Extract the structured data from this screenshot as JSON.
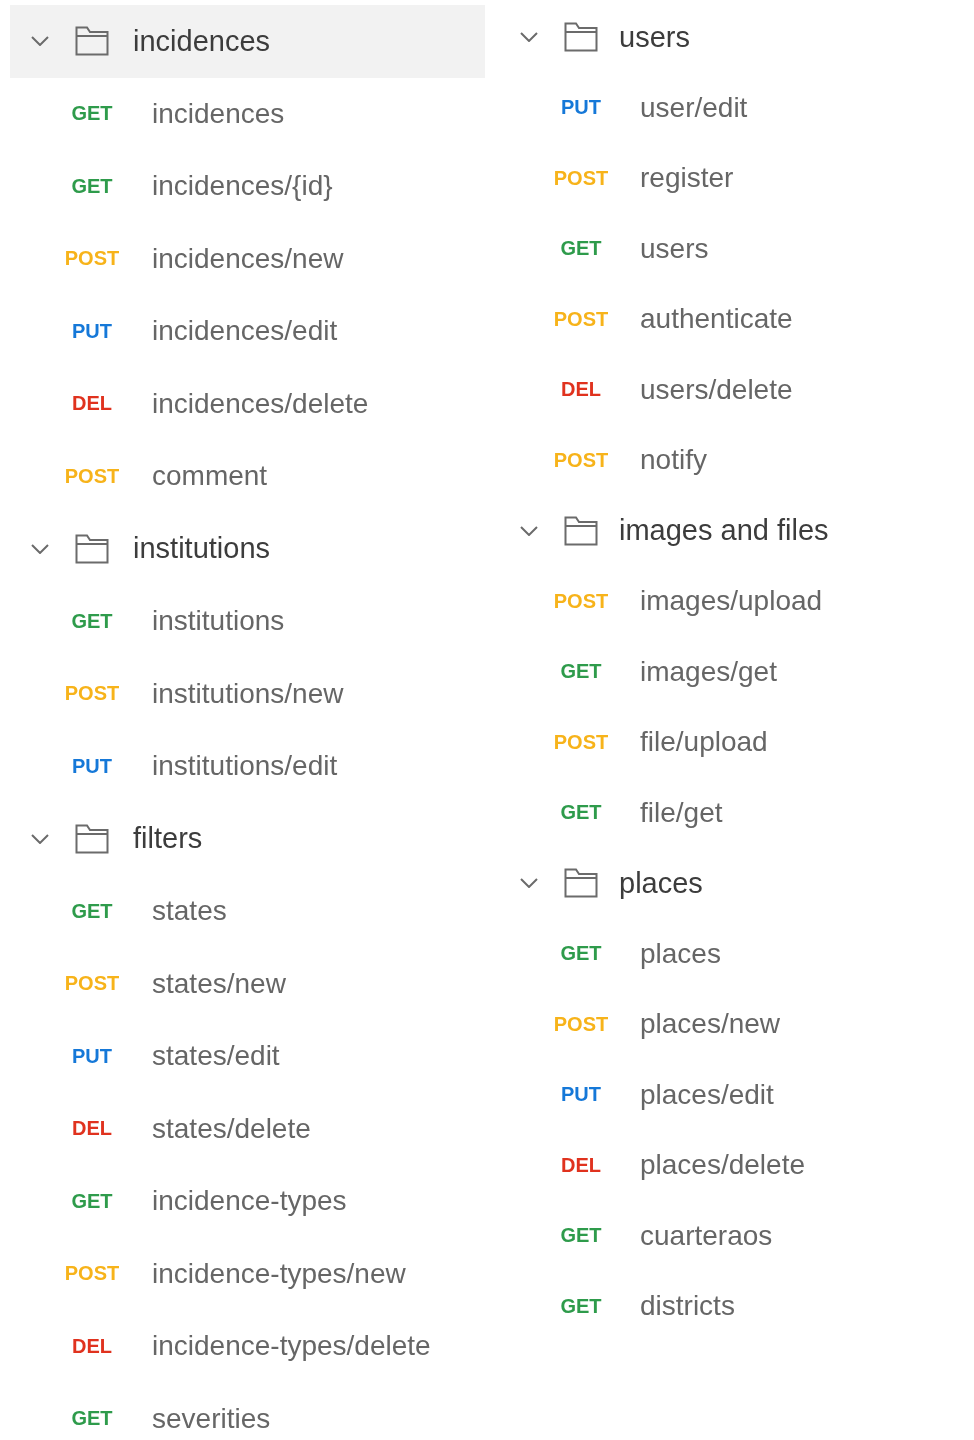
{
  "columns": [
    {
      "folders": [
        {
          "name": "incidences",
          "expanded": true,
          "selected": true,
          "requests": [
            {
              "method": "GET",
              "color": "#2e9b4b",
              "name": "incidences"
            },
            {
              "method": "GET",
              "color": "#2e9b4b",
              "name": "incidences/{id}"
            },
            {
              "method": "POST",
              "color": "#f7b31a",
              "name": "incidences/new"
            },
            {
              "method": "PUT",
              "color": "#1578d8",
              "name": "incidences/edit"
            },
            {
              "method": "DEL",
              "color": "#e0321e",
              "name": "incidences/delete"
            },
            {
              "method": "POST",
              "color": "#f7b31a",
              "name": "comment"
            }
          ]
        },
        {
          "name": "institutions",
          "expanded": true,
          "selected": false,
          "requests": [
            {
              "method": "GET",
              "color": "#2e9b4b",
              "name": "institutions"
            },
            {
              "method": "POST",
              "color": "#f7b31a",
              "name": "institutions/new"
            },
            {
              "method": "PUT",
              "color": "#1578d8",
              "name": "institutions/edit"
            }
          ]
        },
        {
          "name": "filters",
          "expanded": true,
          "selected": false,
          "requests": [
            {
              "method": "GET",
              "color": "#2e9b4b",
              "name": "states"
            },
            {
              "method": "POST",
              "color": "#f7b31a",
              "name": "states/new"
            },
            {
              "method": "PUT",
              "color": "#1578d8",
              "name": "states/edit"
            },
            {
              "method": "DEL",
              "color": "#e0321e",
              "name": "states/delete"
            },
            {
              "method": "GET",
              "color": "#2e9b4b",
              "name": "incidence-types"
            },
            {
              "method": "POST",
              "color": "#f7b31a",
              "name": "incidence-types/new"
            },
            {
              "method": "DEL",
              "color": "#e0321e",
              "name": "incidence-types/delete"
            },
            {
              "method": "GET",
              "color": "#2e9b4b",
              "name": "severities"
            }
          ]
        }
      ]
    },
    {
      "folders": [
        {
          "name": "users",
          "expanded": true,
          "selected": false,
          "requests": [
            {
              "method": "PUT",
              "color": "#1578d8",
              "name": "user/edit"
            },
            {
              "method": "POST",
              "color": "#f7b31a",
              "name": "register"
            },
            {
              "method": "GET",
              "color": "#2e9b4b",
              "name": "users"
            },
            {
              "method": "POST",
              "color": "#f7b31a",
              "name": "authenticate"
            },
            {
              "method": "DEL",
              "color": "#e0321e",
              "name": "users/delete"
            },
            {
              "method": "POST",
              "color": "#f7b31a",
              "name": "notify"
            }
          ]
        },
        {
          "name": "images and files",
          "expanded": true,
          "selected": false,
          "requests": [
            {
              "method": "POST",
              "color": "#f7b31a",
              "name": "images/upload"
            },
            {
              "method": "GET",
              "color": "#2e9b4b",
              "name": "images/get"
            },
            {
              "method": "POST",
              "color": "#f7b31a",
              "name": "file/upload"
            },
            {
              "method": "GET",
              "color": "#2e9b4b",
              "name": "file/get"
            }
          ]
        },
        {
          "name": "places",
          "expanded": true,
          "selected": false,
          "requests": [
            {
              "method": "GET",
              "color": "#2e9b4b",
              "name": "places"
            },
            {
              "method": "POST",
              "color": "#f7b31a",
              "name": "places/new"
            },
            {
              "method": "PUT",
              "color": "#1578d8",
              "name": "places/edit"
            },
            {
              "method": "DEL",
              "color": "#e0321e",
              "name": "places/delete"
            },
            {
              "method": "GET",
              "color": "#2e9b4b",
              "name": "cuarteraos"
            },
            {
              "method": "GET",
              "color": "#2e9b4b",
              "name": "districts"
            }
          ]
        }
      ]
    }
  ]
}
